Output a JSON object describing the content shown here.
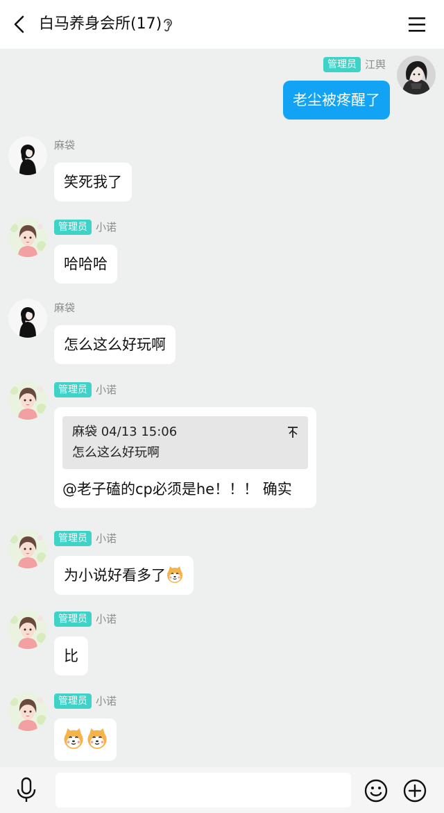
{
  "header": {
    "title": "白马养身会所(17)",
    "icons": [
      "back-arrow-icon",
      "ear-icon",
      "menu-icon"
    ]
  },
  "messages": [
    {
      "sender": "江舆",
      "badge": "管理员",
      "text": "老尘被疼醒了",
      "mine": true
    },
    {
      "sender": "麻袋",
      "text": "笑死我了"
    },
    {
      "sender": "小诺",
      "badge": "管理员",
      "text": "哈哈哈"
    },
    {
      "sender": "麻袋",
      "text": "怎么这么好玩啊"
    },
    {
      "sender": "小诺",
      "badge": "管理员",
      "quote": {
        "author": "麻袋",
        "time": "04/13 15:06",
        "header": "麻袋 04/13 15:06",
        "text": "怎么这么好玩啊"
      },
      "text": "@老子磕的cp必须是he！！！ 确实"
    },
    {
      "sender": "小诺",
      "badge": "管理员",
      "text": "为小说好看多了",
      "emoji": "shiba-dog-emoji"
    },
    {
      "sender": "小诺",
      "badge": "管理员",
      "text": "比"
    },
    {
      "sender": "小诺",
      "badge": "管理员",
      "text": "",
      "emoji": "shiba-dog-emoji x2"
    }
  ],
  "input": {
    "placeholder": "",
    "value": ""
  },
  "toolbar": {
    "icons": [
      "microphone-icon",
      "emoji-icon",
      "plus-icon"
    ]
  },
  "colors": {
    "accent": "#13a3f4",
    "badge": "#3fd2c7",
    "background": "#eef0ef"
  }
}
